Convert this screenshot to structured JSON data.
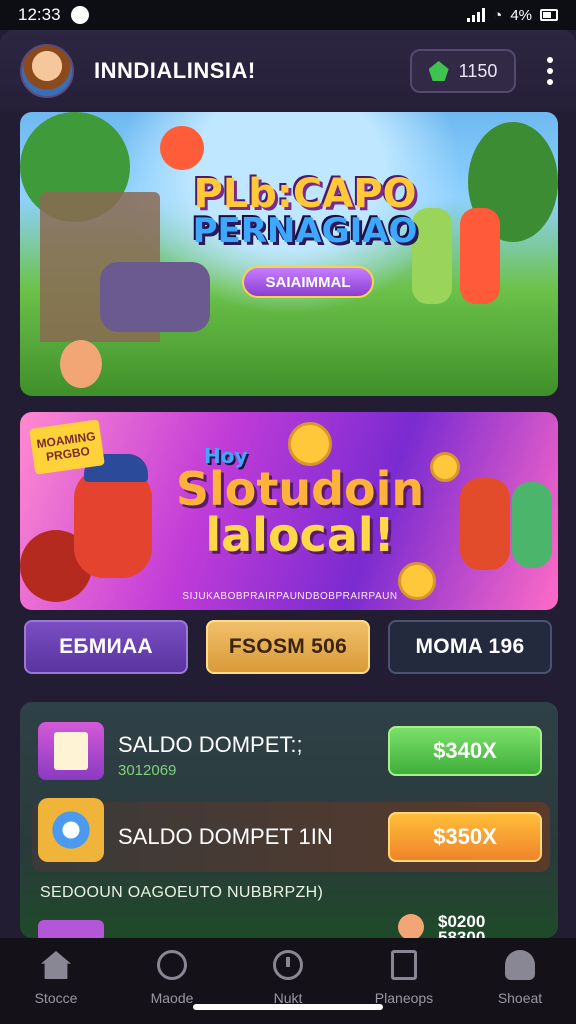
{
  "status_bar": {
    "time": "12:33",
    "battery": "4%"
  },
  "header": {
    "title": "INNDIALINSIA!",
    "coins": "1150"
  },
  "banner1": {
    "line1": "PLb:CAPO",
    "line2": "PERNAGIAO",
    "button": "SAIAIMMAL"
  },
  "banner2": {
    "badge_line1": "MOAMING",
    "badge_line2": "PRGBO",
    "line1": "Hoy",
    "line2": "Slotudoin",
    "line3": "lalocal!",
    "footer": "SIJUKABOBPRAIRPAUNDBOBPRAIRPAUN"
  },
  "tabs": [
    {
      "label": "EБMИAA"
    },
    {
      "label": "FSOSM 506"
    },
    {
      "label": "MOMA 196"
    }
  ],
  "wallet": {
    "row1": {
      "label": "SALDO DOMPET:;",
      "sub": "3012069",
      "button": "$340X"
    },
    "row2": {
      "label": "SALDO DOMPET 1IN",
      "button": "$350X"
    },
    "promo": "SEDOOUN OAGOEUTO NUBBRPZH)",
    "row3_value": "$0200\n58300"
  },
  "bottom_nav": [
    {
      "label": "Stoсce",
      "icon": "home-icon"
    },
    {
      "label": "Maode",
      "icon": "mode-icon"
    },
    {
      "label": "Nukt",
      "icon": "next-icon"
    },
    {
      "label": "Planeops",
      "icon": "pages-icon"
    },
    {
      "label": "Shoeat",
      "icon": "user-icon"
    }
  ],
  "colors": {
    "background": "#221d33",
    "accent_green": "#3fae3a",
    "accent_orange": "#f0842a",
    "accent_purple": "#7a4ec2"
  }
}
